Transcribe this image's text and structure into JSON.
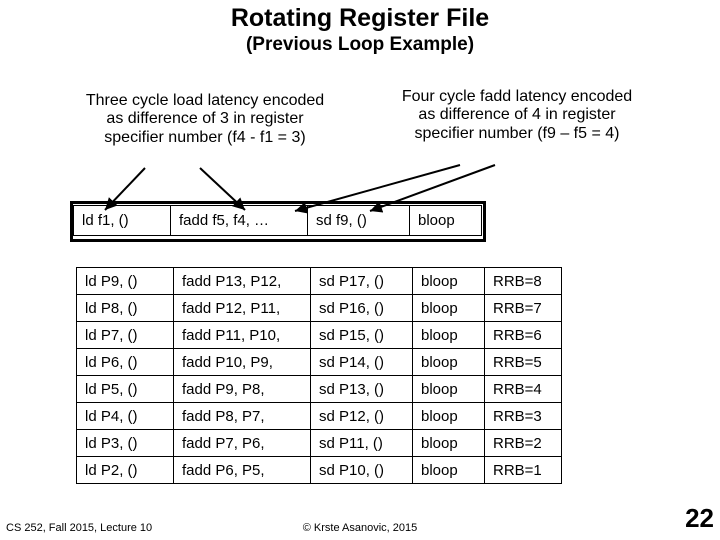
{
  "title": "Rotating Register File",
  "subtitle": "(Previous Loop Example)",
  "note_left": "Three cycle load latency encoded as difference of 3 in register specifier number (f4 - f1 = 3)",
  "note_right": "Four cycle fadd latency encoded as difference of 4 in register specifier number (f9 – f5 = 4)",
  "header_row": {
    "c0": "ld f1, ()",
    "c1": "fadd f5, f4, …",
    "c2": "sd f9, ()",
    "c3": "bloop"
  },
  "rows": [
    {
      "c0": "ld P9, ()",
      "c1": "fadd P13, P12,",
      "c2": "sd P17, ()",
      "c3": "bloop",
      "c4": "RRB=8"
    },
    {
      "c0": "ld P8, ()",
      "c1": "fadd P12, P11,",
      "c2": "sd P16, ()",
      "c3": "bloop",
      "c4": "RRB=7"
    },
    {
      "c0": "ld P7, ()",
      "c1": "fadd P11, P10,",
      "c2": "sd P15, ()",
      "c3": "bloop",
      "c4": "RRB=6"
    },
    {
      "c0": "ld P6, ()",
      "c1": "fadd P10, P9,",
      "c2": "sd P14, ()",
      "c3": "bloop",
      "c4": "RRB=5"
    },
    {
      "c0": "ld P5, ()",
      "c1": "fadd P9, P8,",
      "c2": "sd P13, ()",
      "c3": "bloop",
      "c4": "RRB=4"
    },
    {
      "c0": "ld P4, ()",
      "c1": "fadd P8, P7,",
      "c2": "sd P12, ()",
      "c3": "bloop",
      "c4": "RRB=3"
    },
    {
      "c0": "ld P3, ()",
      "c1": "fadd P7, P6,",
      "c2": "sd P11, ()",
      "c3": "bloop",
      "c4": "RRB=2"
    },
    {
      "c0": "ld P2, ()",
      "c1": "fadd P6, P5,",
      "c2": "sd P10, ()",
      "c3": "bloop",
      "c4": "RRB=1"
    }
  ],
  "footer_left": "CS 252, Fall 2015, Lecture 10",
  "footer_center": "© Krste Asanovic, 2015",
  "pagenum": "22"
}
